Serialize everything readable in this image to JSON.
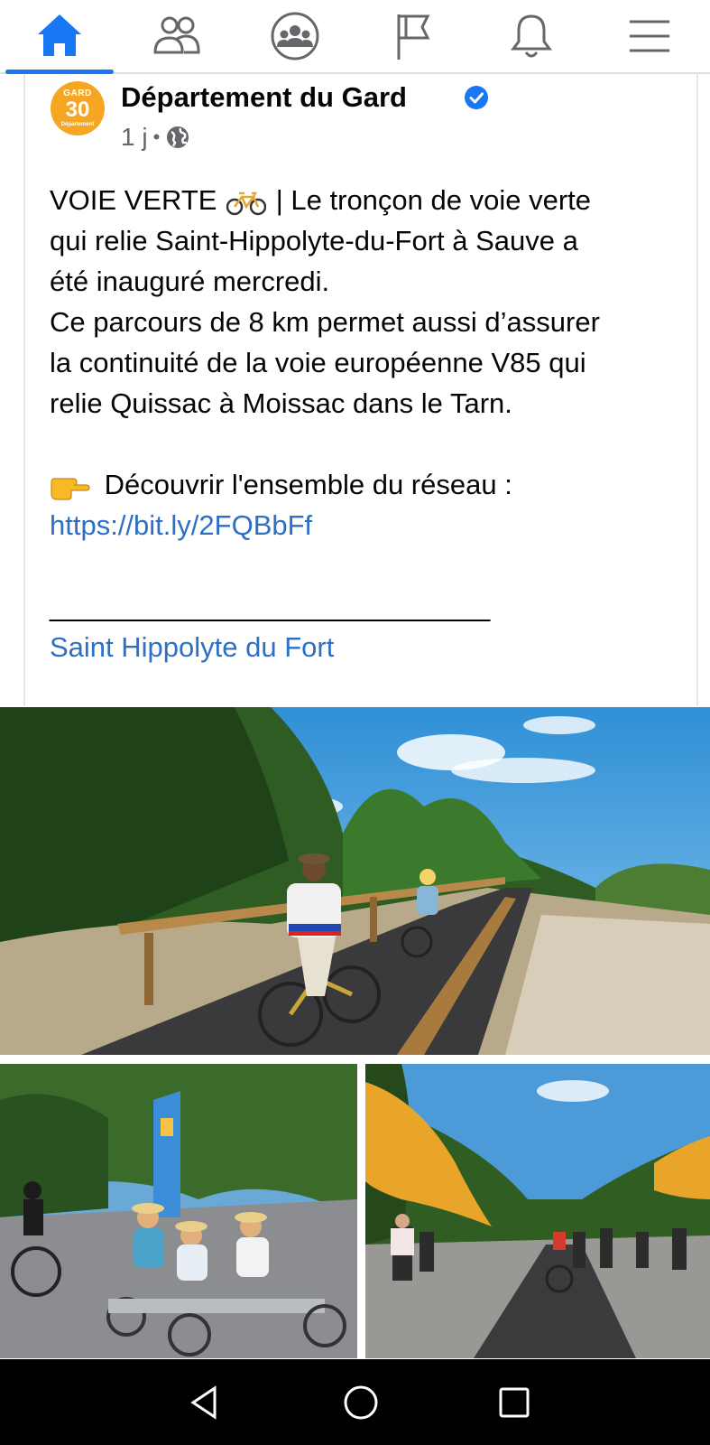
{
  "nav": {
    "items": [
      {
        "name": "home",
        "icon": "home-icon",
        "active": true
      },
      {
        "name": "friends",
        "icon": "friends-icon",
        "active": false
      },
      {
        "name": "groups",
        "icon": "groups-icon",
        "active": false
      },
      {
        "name": "pages",
        "icon": "flag-icon",
        "active": false
      },
      {
        "name": "notifications",
        "icon": "bell-icon",
        "active": false
      },
      {
        "name": "menu",
        "icon": "hamburger-menu-icon",
        "active": false
      }
    ],
    "accent_color": "#1877f2",
    "inactive_color": "#65676b"
  },
  "post": {
    "avatar": {
      "top": "GARD",
      "number": "30",
      "bottom": "Département",
      "color": "#f5a623"
    },
    "author": "Département du Gard",
    "verified": true,
    "time": "1 j",
    "separator": "•",
    "audience_icon": "globe-icon",
    "text": {
      "line1_pre": "VOIE VERTE",
      "line1_post": "| Le tronçon de voie verte",
      "line2": "qui relie Saint-Hippolyte-du-Fort à Sauve a",
      "line3": "été inauguré mercredi.",
      "line4": "Ce parcours de 8 km permet aussi d’assurer",
      "line5": "la continuité de la voie européenne V85 qui",
      "line6": "relie Quissac à Moissac dans le Tarn.",
      "line8": "Découvrir l'ensemble du réseau :",
      "link": "https://bit.ly/2FQBbFf",
      "divider": "______________________________",
      "location_link": "Saint Hippolyte du Fort"
    },
    "link_color": "#2d6fc4"
  },
  "photos": [
    {
      "name": "cyclists-on-greenway-photo"
    },
    {
      "name": "recumbent-bikes-crowd-photo"
    },
    {
      "name": "flags-inauguration-crowd-photo"
    }
  ],
  "system_nav": {
    "back": "back-icon",
    "home": "home-circle-icon",
    "recents": "recents-square-icon"
  }
}
